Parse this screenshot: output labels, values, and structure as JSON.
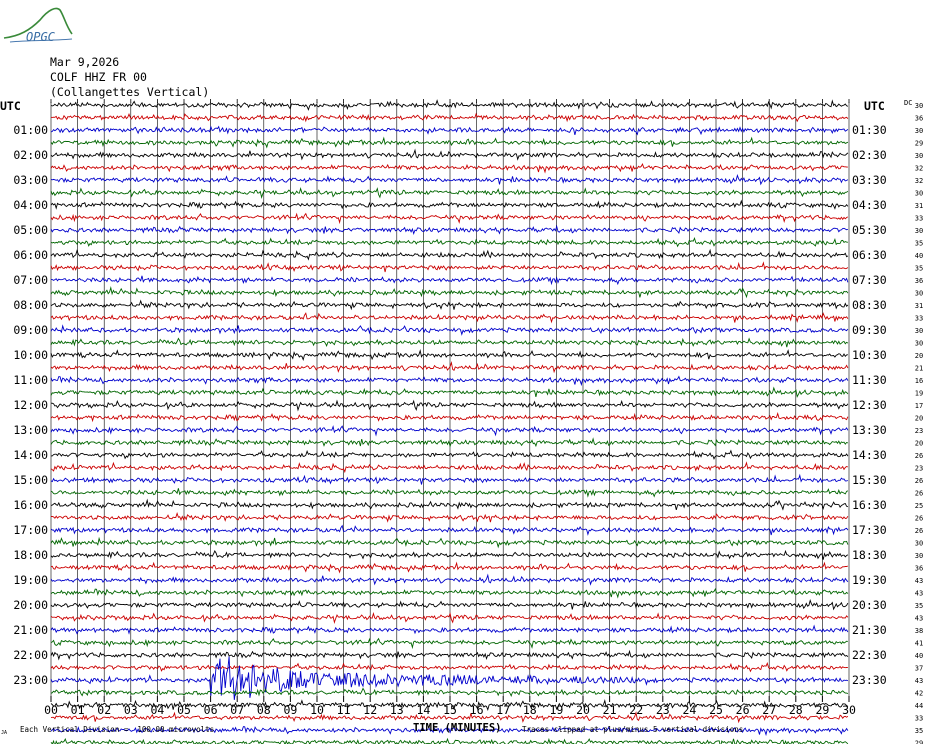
{
  "header": {
    "logo_text": "OPGC",
    "date": "Mar 9,2026",
    "station": "COLF HHZ FR 00",
    "location": "(Collangettes Vertical)",
    "utc_left": "UTC",
    "utc_right": "UTC",
    "dc_label": "DC"
  },
  "footer": {
    "scale_text": "Each Vertical Division =  100.00 microvolts",
    "axis_title": "TIME (MINUTES)",
    "clip_text": "Traces clipped at plus/minus 5 vertical divisions",
    "corner_mark": "JA"
  },
  "chart_data": {
    "type": "line",
    "title": "",
    "xlabel": "TIME (MINUTES)",
    "ylabel": "",
    "x_ticks": [
      "00",
      "01",
      "02",
      "03",
      "04",
      "05",
      "06",
      "07",
      "08",
      "09",
      "10",
      "11",
      "12",
      "13",
      "14",
      "15",
      "16",
      "17",
      "18",
      "19",
      "20",
      "21",
      "22",
      "23",
      "24",
      "25",
      "26",
      "27",
      "28",
      "29",
      "30"
    ],
    "xlim": [
      0,
      30
    ],
    "rows_per_hour": 2,
    "trace_colors": [
      "#000000",
      "#cc0000",
      "#0000cc",
      "#006600"
    ],
    "grid": true,
    "left_labels": [
      "UTC",
      "01:00",
      "02:00",
      "03:00",
      "04:00",
      "05:00",
      "06:00",
      "07:00",
      "08:00",
      "09:00",
      "10:00",
      "11:00",
      "12:00",
      "13:00",
      "14:00",
      "15:00",
      "16:00",
      "17:00",
      "18:00",
      "19:00",
      "20:00",
      "21:00",
      "22:00",
      "23:00"
    ],
    "right_labels": [
      "UTC",
      "01:30",
      "02:30",
      "03:30",
      "04:30",
      "05:30",
      "06:30",
      "07:30",
      "08:30",
      "09:30",
      "10:30",
      "11:30",
      "12:30",
      "13:30",
      "14:30",
      "15:30",
      "16:30",
      "17:30",
      "18:30",
      "19:30",
      "20:30",
      "21:30",
      "22:30",
      "23:30"
    ],
    "dc_values": [
      "30",
      "36",
      "30",
      "29",
      "30",
      "32",
      "32",
      "30",
      "31",
      "33",
      "30",
      "35",
      "40",
      "35",
      "36",
      "30",
      "31",
      "33",
      "30",
      "30",
      "20",
      "21",
      "16",
      "19",
      "17",
      "20",
      "23",
      "20",
      "26",
      "23",
      "26",
      "26",
      "25",
      "26",
      "26",
      "30",
      "30",
      "36",
      "43",
      "43",
      "35",
      "43",
      "38",
      "41",
      "40",
      "37",
      "43",
      "42",
      "44",
      "33",
      "35",
      "29"
    ],
    "events": [
      {
        "row": 46,
        "start_min": 6.0,
        "end_min": 22.0,
        "label": ""
      }
    ]
  }
}
